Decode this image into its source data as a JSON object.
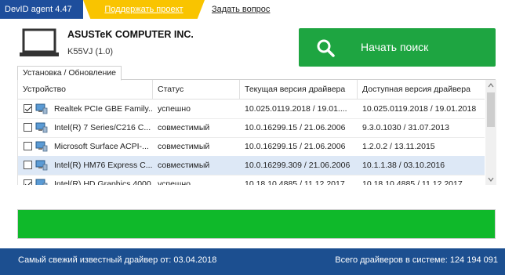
{
  "app": {
    "title": "DevID agent 4.47",
    "support_link": "Поддержать проект",
    "ask_link": "Задать вопрос"
  },
  "device": {
    "name": "ASUSTeK COMPUTER INC.",
    "model": "K55VJ (1.0)"
  },
  "search_button": {
    "label": "Начать поиск",
    "icon": "search-icon",
    "color": "#1ea541"
  },
  "tabs": [
    {
      "label": "Установка / Обновление"
    }
  ],
  "table": {
    "columns": [
      "Устройство",
      "Статус",
      "Текущая версия драйвера",
      "Доступная версия драйвера"
    ],
    "rows": [
      {
        "checked": true,
        "device": "Realtek PCIe GBE Family...",
        "status": "успешно",
        "current": "10.025.0119.2018 / 19.01....",
        "available": "10.025.0119.2018 / 19.01.2018"
      },
      {
        "checked": false,
        "device": "Intel(R) 7 Series/C216 C...",
        "status": "совместимый",
        "current": "10.0.16299.15 / 21.06.2006",
        "available": "9.3.0.1030 / 31.07.2013"
      },
      {
        "checked": false,
        "device": "Microsoft Surface ACPI-...",
        "status": "совместимый",
        "current": "10.0.16299.15 / 21.06.2006",
        "available": "1.2.0.2 / 13.11.2015"
      },
      {
        "checked": false,
        "device": "Intel(R) HM76 Express C...",
        "status": "совместимый",
        "current": "10.0.16299.309 / 21.06.2006",
        "available": "10.1.1.38 / 03.10.2016",
        "selected": true
      },
      {
        "checked": true,
        "device": "Intel(R) HD Graphics 4000",
        "status": "успешно",
        "current": "10.18.10.4885 / 11.12.2017",
        "available": "10.18.10.4885 / 11.12.2017"
      }
    ]
  },
  "progress": {
    "value": 1.0,
    "color": "#0fb92a"
  },
  "footer": {
    "latest_driver": "Самый свежий известный драйвер от: 03.04.2018",
    "total_drivers": "Всего драйверов в системе: 124 194 091"
  },
  "colors": {
    "brand_blue": "#1e4e9c",
    "accent_yellow": "#f9c400"
  }
}
